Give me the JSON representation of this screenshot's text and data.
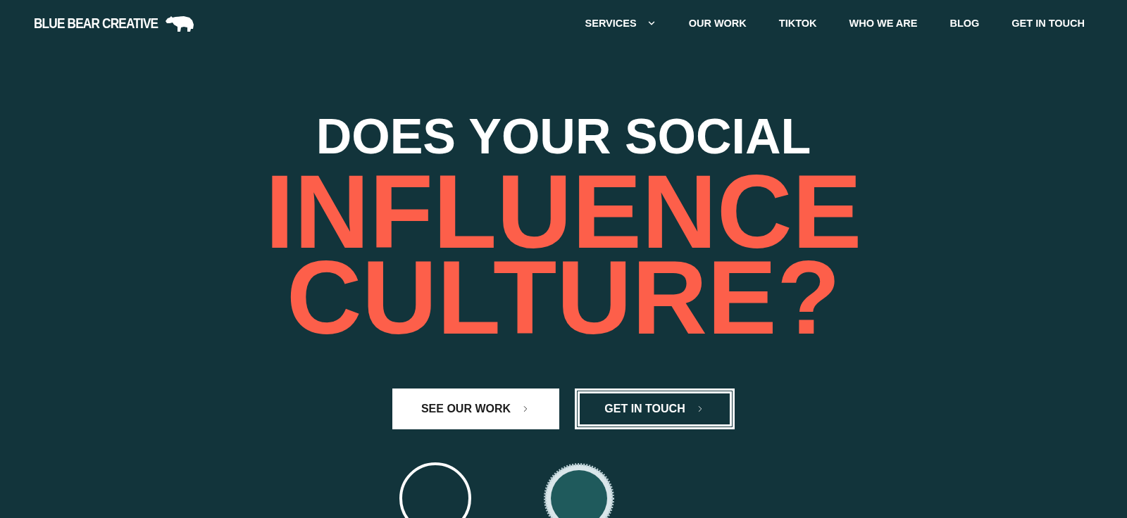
{
  "logo": {
    "text": "BLUE BEAR CREATIVE"
  },
  "nav": [
    {
      "label": "SERVICES",
      "kind": "dropdown"
    },
    {
      "label": "OUR WORK",
      "kind": "link"
    },
    {
      "label": "TIKTOK",
      "kind": "link"
    },
    {
      "label": "WHO WE ARE",
      "kind": "link"
    },
    {
      "label": "BLOG",
      "kind": "link"
    },
    {
      "label": "GET IN TOUCH",
      "kind": "link"
    }
  ],
  "hero": {
    "kicker": "DOES YOUR SOCIAL",
    "headline": [
      "INFLUENCE",
      "CULTURE?"
    ]
  },
  "buttons": [
    {
      "label": "SEE OUR WORK",
      "kind": "solid"
    },
    {
      "label": "GET IN TOUCH",
      "kind": "outline"
    }
  ]
}
